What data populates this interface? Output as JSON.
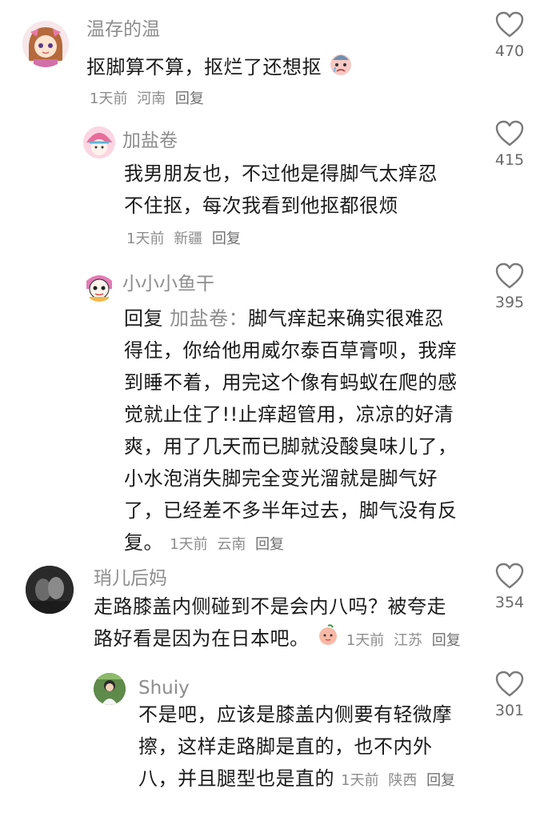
{
  "comments": [
    {
      "username": "温存的温",
      "text": "抠脚算不算，抠烂了还想抠",
      "time": "1天前",
      "location": "河南",
      "reply_label": "回复",
      "likes": "470",
      "avatar_icon": "anime-girl-avatar",
      "inline_emoji": "crying-sticker-emoji"
    },
    {
      "username": "加盐卷",
      "text": "我男朋友也，不过他是得脚气太痒忍不住抠，每次我看到他抠都很烦",
      "time": "1天前",
      "location": "新疆",
      "reply_label": "回复",
      "likes": "415",
      "avatar_icon": "pink-hat-avatar"
    },
    {
      "username": "小小小鱼干",
      "reply_prefix": "回复",
      "reply_to": "加盐卷：",
      "text": "脚气痒起来确实很难忍得住，你给他用威尔泰百草膏呗，我痒到睡不着，用完这个像有蚂蚁在爬的感觉就止住了!!止痒超管用，凉凉的好清爽，用了几天而已脚就没酸臭味儿了，小水泡消失脚完全变光溜就是脚气好了，已经差不多半年过去，脚气没有反复。",
      "time": "1天前",
      "location": "云南",
      "reply_label": "回复",
      "likes": "395",
      "avatar_icon": "cartoon-face-avatar"
    },
    {
      "username": "琑儿后妈",
      "text": "走路膝盖内侧碰到不是会内八吗？被夸走路好看是因为在日本吧。",
      "time": "1天前",
      "location": "江苏",
      "reply_label": "回复",
      "likes": "354",
      "avatar_icon": "dark-photo-avatar",
      "inline_emoji": "peach-face-emoji"
    },
    {
      "username": "Shuiy",
      "text": "不是吧，应该是膝盖内侧要有轻微摩擦，这样走路脚是直的，也不内外八，并且腿型也是直的",
      "time": "1天前",
      "location": "陕西",
      "reply_label": "回复",
      "likes": "301",
      "avatar_icon": "green-photo-avatar"
    }
  ],
  "colors": {
    "text": "#1a1a1a",
    "secondary": "#8d8d8d",
    "background": "#ffffff"
  },
  "icons": {
    "like": "heart-outline-icon"
  }
}
